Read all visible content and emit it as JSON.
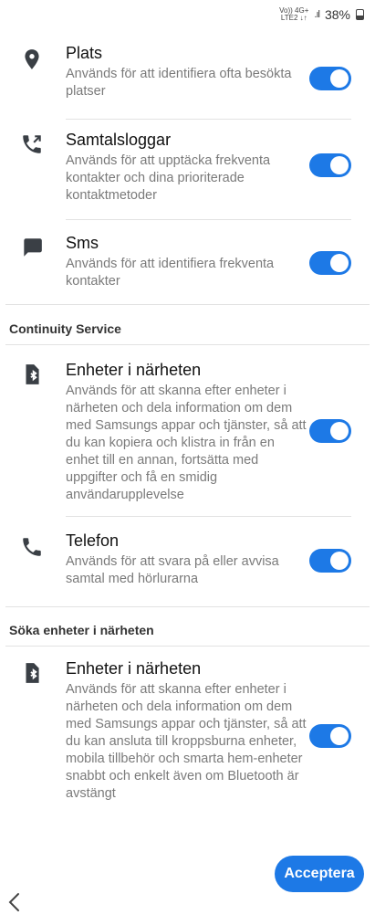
{
  "status_bar": {
    "network_top": "Vo)) 4G+",
    "network_bottom": "LTE2 ↓↑",
    "signal": ".ıl",
    "battery": "38%"
  },
  "permissions": [
    {
      "icon": "location-icon",
      "title": "Plats",
      "description": "Används för att identifiera ofta besökta platser",
      "enabled": true
    },
    {
      "icon": "call-log-icon",
      "title": "Samtalsloggar",
      "description": "Används för att upptäcka frekventa kontakter och dina prioriterade kontaktmetoder",
      "enabled": true
    },
    {
      "icon": "sms-icon",
      "title": "Sms",
      "description": "Används för att identifiera frekventa kontakter",
      "enabled": true
    }
  ],
  "continuity": {
    "header": "Continuity Service",
    "items": [
      {
        "icon": "nearby-devices-icon",
        "title": "Enheter i närheten",
        "description": "Används för att skanna efter enheter i närheten och dela information om dem med Samsungs appar och tjänster, så att du kan kopiera och klistra in från en enhet till en annan, fortsätta med uppgifter och få en smidig användarupplevelse",
        "enabled": true
      },
      {
        "icon": "phone-icon",
        "title": "Telefon",
        "description": "Används för att svara på eller avvisa samtal med hörlurarna",
        "enabled": true
      }
    ]
  },
  "nearby": {
    "header": "Söka enheter i närheten",
    "items": [
      {
        "icon": "nearby-devices-icon",
        "title": "Enheter i närheten",
        "description": "Används för att skanna efter enheter i närheten och dela information om dem med Samsungs appar och tjänster, så att du kan ansluta till kroppsburna enheter, mobila tillbehör och smarta hem-enheter snabbt och enkelt även om Bluetooth är avstängt",
        "enabled": true
      }
    ]
  },
  "accept_button": "Acceptera",
  "colors": {
    "accent": "#1d79e6",
    "icon": "#3a3f45"
  }
}
